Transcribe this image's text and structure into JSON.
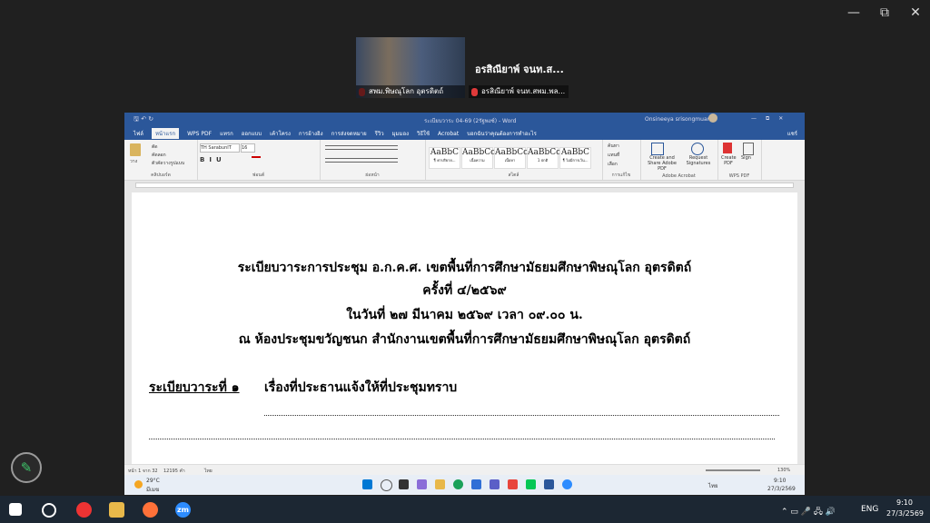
{
  "window_controls": {
    "minimize": "—",
    "restore": "⧉",
    "close": "✕"
  },
  "participant": {
    "tile_label": "สพม.พิษณุโลก อุตรดิตถ์",
    "name": "อรสิณียาพ์ จนท.ส...",
    "name_full": "อรสิณียาพ์ จนท.สพม.พล..."
  },
  "word": {
    "title": "ระเบียบวาระ 04-69 (2รัฐพงช์) - Word",
    "user": "Onsineeya srisongmuang",
    "menu": [
      "ไฟล์",
      "หน้าแรก",
      "WPS PDF",
      "แทรก",
      "ออกแบบ",
      "เค้าโครง",
      "การอ้างอิง",
      "การส่งจดหมาย",
      "รีวิว",
      "มุมมอง",
      "วิธีใช้",
      "Acrobat",
      "บอกฉันว่าคุณต้องการทำอะไร"
    ],
    "share": "แชร์",
    "ribbon": {
      "clipboard_label": "คลิปบอร์ด",
      "paste": "วาง",
      "cut": "ตัด",
      "copy": "คัดลอก",
      "format_painter": "ตัวคัดวางรูปแบบ",
      "font_name": "TH SarabunIT",
      "font_size": "16",
      "font_label": "ฟอนต์",
      "paragraph_label": "ย่อหน้า",
      "styles_label": "สไตล์",
      "styles": [
        {
          "sample": "AaBbC",
          "name": "¶ ค่าปริยาย..."
        },
        {
          "sample": "AaBbCcE",
          "name": "เนื้อความ"
        },
        {
          "sample": "AaBbCcD",
          "name": "เนื้อหา"
        },
        {
          "sample": "AaBbCcD",
          "name": "1 ปกติ"
        },
        {
          "sample": "AaBbC",
          "name": "¶ ไม่มีการเว้น..."
        }
      ],
      "find": "ค้นหา",
      "replace": "แทนที่",
      "select": "เลือก",
      "editing_label": "การแก้ไข",
      "create_share": "Create and Share Adobe PDF",
      "request_sig": "Request Signatures",
      "adobe_label": "Adobe Acrobat",
      "create_pdf": "Create PDF",
      "sign": "Sign",
      "wps_label": "WPS PDF"
    },
    "document": {
      "lines": [
        "ระเบียบวาระการประชุม อ.ก.ค.ศ. เขตพื้นที่การศึกษามัธยมศึกษาพิษณุโลก อุตรดิตถ์",
        "ครั้งที่  ๔/๒๕๖๙",
        "ในวันที่  ๒๗  มีนาคม  ๒๕๖๙  เวลา  ๐๙.๐๐  น.",
        "ณ ห้องประชุมขวัญชนก สำนักงานเขตพื้นที่การศึกษามัธยมศึกษาพิษณุโลก อุตรดิตถ์"
      ],
      "agenda_label": "ระเบียบวาระที่  ๑",
      "agenda_text": "เรื่องที่ประธานแจ้งให้ที่ประชุมทราบ"
    },
    "status": {
      "page": "หน้า 1 จาก 32",
      "words": "12195 คำ",
      "lang": "ไทย",
      "zoom": "130%"
    }
  },
  "inner_taskbar": {
    "weather_temp": "29°C",
    "weather_desc": "มีเมฆ",
    "time": "9:10",
    "date": "27/3/2569",
    "lang": "ไทย"
  },
  "taskbar": {
    "lang": "ENG",
    "time": "9:10",
    "date": "27/3/2569",
    "zoom_label": "zm"
  },
  "colors": {
    "word_blue": "#2b579a",
    "taskbar": "#1c2733",
    "pen_green": "#3fc46a"
  }
}
